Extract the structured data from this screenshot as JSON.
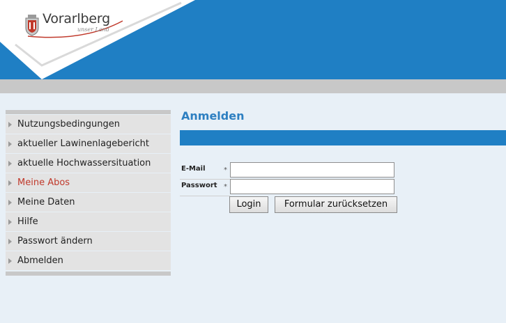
{
  "header": {
    "logo_title": "Vorarlberg",
    "logo_subtitle": "unser Land",
    "colors": {
      "blue": "#1f7fc4",
      "gray_band": "#c8c8c8"
    }
  },
  "sidebar": {
    "items": [
      {
        "label": "Nutzungsbedingungen",
        "active": false
      },
      {
        "label": "aktueller Lawinenlagebericht",
        "active": false
      },
      {
        "label": "aktuelle Hochwassersituation",
        "active": false
      },
      {
        "label": "Meine Abos",
        "active": true
      },
      {
        "label": "Meine Daten",
        "active": false
      },
      {
        "label": "Hilfe",
        "active": false
      },
      {
        "label": "Passwort ändern",
        "active": false
      },
      {
        "label": "Abmelden",
        "active": false
      }
    ],
    "active_color": "#c0392b"
  },
  "main": {
    "title": "Anmelden",
    "form": {
      "email_label": "E-Mail",
      "email_required": "*",
      "email_value": "",
      "password_label": "Passwort",
      "password_required": "*",
      "password_value": "",
      "login_button": "Login",
      "reset_button": "Formular zurücksetzen"
    }
  }
}
